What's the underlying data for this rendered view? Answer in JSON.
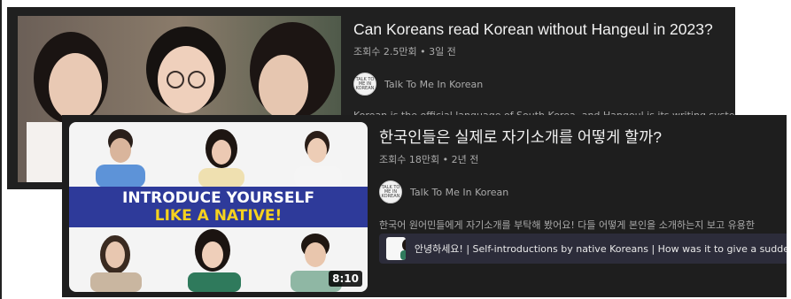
{
  "videos": [
    {
      "title": "Can Koreans read Korean without Hangeul in 2023?",
      "meta": "조회수 2.5만회 • 3일 전",
      "channel": "Talk To Me In Korean",
      "description": "Korean is the official language of South Korea, and Hangeul is its writing system."
    },
    {
      "title": "한국인들은 실제로 자기소개를 어떻게 할까?",
      "meta": "조회수 18만회 • 2년 전",
      "channel": "Talk To Me In Korean",
      "description": "한국어 원어민들에게 자기소개를 부탁해 봤어요! 다들 어떻게 본인을 소개하는지 보고 유용한",
      "thumbnail_banner": {
        "line1": "INTRODUCE YOURSELF",
        "line2": "LIKE A NATIVE!"
      },
      "duration": "8:10",
      "chapter": "안녕하세요! | Self-introductions by native Koreans | How was it to give a sudden"
    }
  ],
  "channel_avatar_text": "TALK TO ME IN KOREAN",
  "colors": {
    "card_bg": "#202020",
    "title": "#f1f1f1",
    "meta": "#aaaaaa",
    "banner_bg": "#2e3a9a",
    "banner_accent": "#f5d21e",
    "chapter_bg": "#2c2c3a"
  }
}
